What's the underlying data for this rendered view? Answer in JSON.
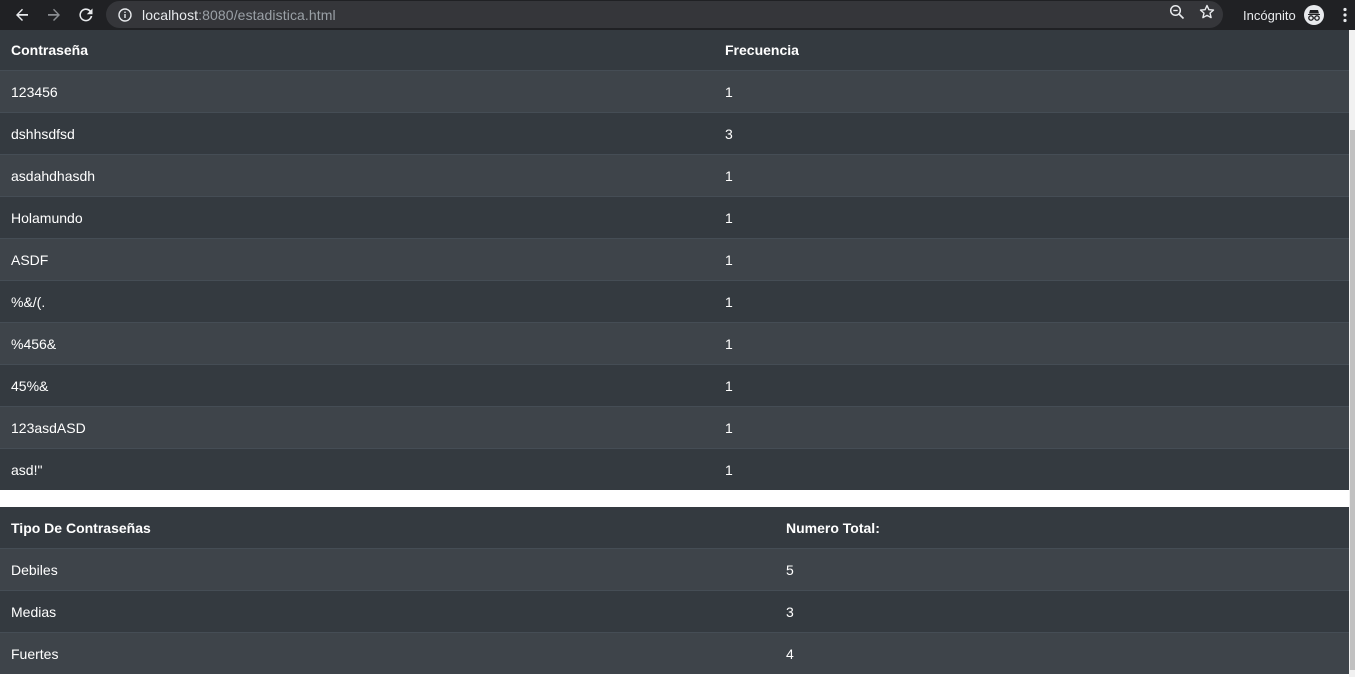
{
  "browser": {
    "url_host": "localhost",
    "url_rest": ":8080/estadistica.html",
    "profile_label": "Incógnito"
  },
  "frequency_table": {
    "headers": [
      "Contraseña",
      "Frecuencia"
    ],
    "rows": [
      [
        "123456",
        "1"
      ],
      [
        "dshhsdfsd",
        "3"
      ],
      [
        "asdahdhasdh",
        "1"
      ],
      [
        "Holamundo",
        "1"
      ],
      [
        "ASDF",
        "1"
      ],
      [
        "%&/(.",
        "1"
      ],
      [
        "%456&",
        "1"
      ],
      [
        "45%&",
        "1"
      ],
      [
        "123asdASD",
        "1"
      ],
      [
        "asd!\"",
        "1"
      ]
    ]
  },
  "summary_table": {
    "headers": [
      "Tipo De Contraseñas",
      "Numero Total:"
    ],
    "rows": [
      [
        "Debiles",
        "5"
      ],
      [
        "Medias",
        "3"
      ],
      [
        "Fuertes",
        "4"
      ]
    ]
  },
  "colors": {
    "chrome_bg": "#202124",
    "omnibox_bg": "#35363a",
    "table_dark": "#343a40",
    "table_stripe": "#3e444a",
    "text": "#ffffff"
  }
}
